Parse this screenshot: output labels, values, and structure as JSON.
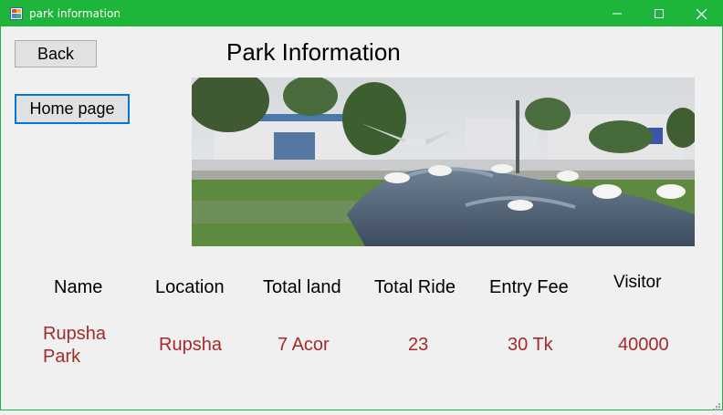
{
  "window": {
    "title": "park information"
  },
  "buttons": {
    "back": "Back",
    "home": "Home page"
  },
  "page_title": "Park Information",
  "table": {
    "headers": [
      "Name",
      "Location",
      "Total land",
      "Total Ride",
      "Entry Fee",
      "Visitor"
    ],
    "row": {
      "name_line1": "Rupsha",
      "name_line2": "Park",
      "location": "Rupsha",
      "total_land": "7 Acor",
      "total_ride": "23",
      "entry_fee": "30 Tk",
      "visitor": "40000"
    }
  },
  "colors": {
    "titlebar": "#1db53a",
    "value_text": "#a52a2a",
    "focus_border": "#0078d7"
  },
  "icons": {
    "app": "app-window-icon",
    "minimize": "minimize-icon",
    "maximize": "maximize-icon",
    "close": "close-icon"
  }
}
